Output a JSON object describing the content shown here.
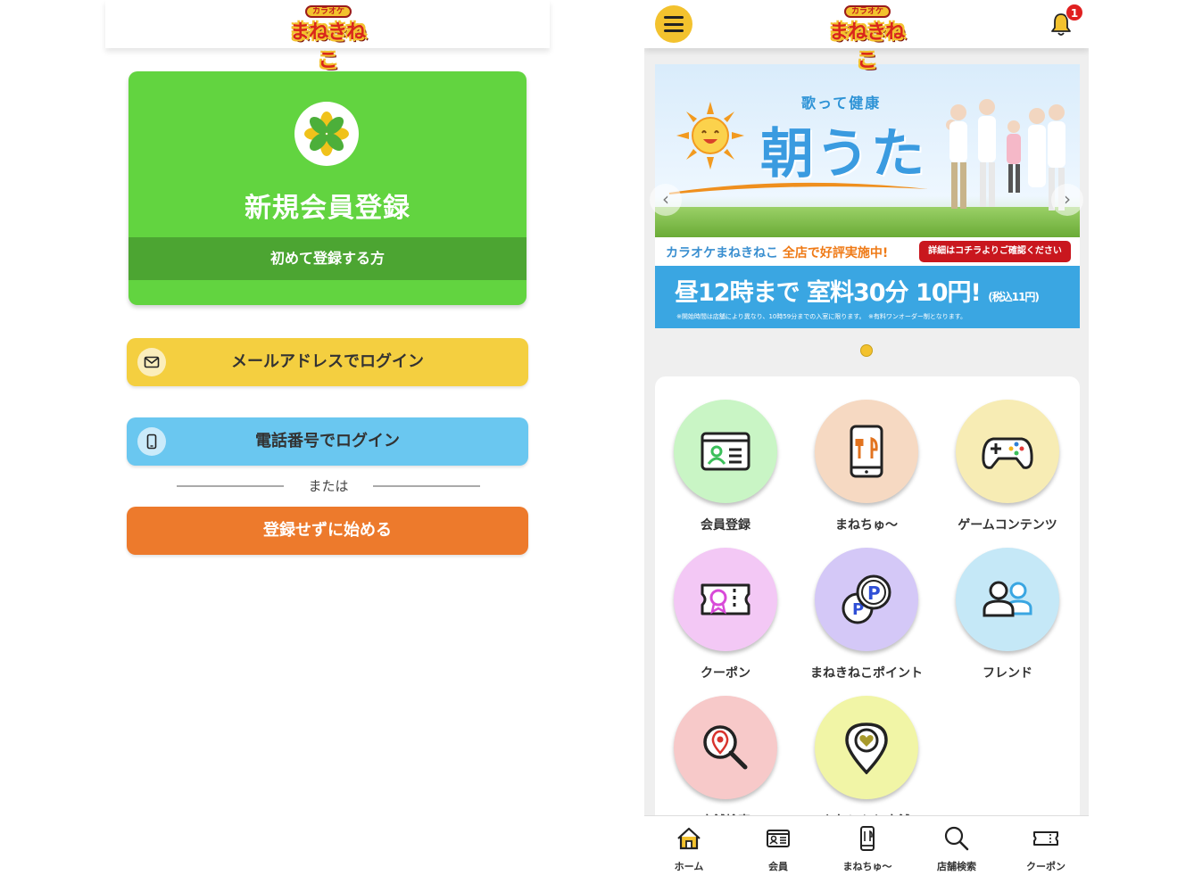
{
  "left_screen": {
    "logo": {
      "top_text": "カラオケ",
      "main_text": "まねきねこ"
    },
    "register_card": {
      "title": "新規会員登録",
      "subtitle": "初めて登録する方"
    },
    "email_login": {
      "label": "メールアドレスでログイン",
      "icon": "mail-icon"
    },
    "phone_login": {
      "label": "電話番号でログイン",
      "icon": "smartphone-icon"
    },
    "divider_text": "または",
    "guest_start": {
      "label": "登録せずに始める"
    }
  },
  "right_screen": {
    "logo": {
      "top_text": "カラオケ",
      "main_text": "まねきねこ"
    },
    "notification_count": "1",
    "banner": {
      "subtitle": "歌って健康",
      "title": "朝うた",
      "info_left_prefix": "カラオケまねきねこ",
      "info_left_highlight": "全店で好評実施中!",
      "info_right": "詳細はコチラよりご確認ください",
      "price_text": "昼12時まで 室料30分 10円!",
      "price_small": "(税込11円)",
      "note": "※開始時間は店舗により異なり、10時59分までの入室に限ります。　※有料ワンオーダー制となります。",
      "active_slide": 1,
      "slide_count": 1
    },
    "grid": [
      {
        "label": "会員登録",
        "icon": "member-card-icon",
        "color": "#c9f5c5"
      },
      {
        "label": "まねちゅ〜",
        "icon": "mobile-order-icon",
        "color": "#f6d9c2"
      },
      {
        "label": "ゲームコンテンツ",
        "icon": "game-controller-icon",
        "color": "#f7ecb4"
      },
      {
        "label": "クーポン",
        "icon": "coupon-ticket-icon",
        "color": "#f3c8f5"
      },
      {
        "label": "まねきねこポイント",
        "icon": "point-coins-icon",
        "color": "#d4c8f7"
      },
      {
        "label": "フレンド",
        "icon": "friends-icon",
        "color": "#c5e8f7"
      },
      {
        "label": "店舗検索",
        "icon": "store-search-icon",
        "color": "#f7c9c9"
      },
      {
        "label": "お気に入り店舗",
        "icon": "favorite-store-icon",
        "color": "#f1f5a6"
      }
    ],
    "tabbar": [
      {
        "label": "ホーム",
        "icon": "home-icon"
      },
      {
        "label": "会員",
        "icon": "member-card-icon"
      },
      {
        "label": "まねちゅ〜",
        "icon": "mobile-order-icon"
      },
      {
        "label": "店舗検索",
        "icon": "search-icon"
      },
      {
        "label": "クーポン",
        "icon": "coupon-icon"
      }
    ],
    "colors": {
      "accent_yellow": "#f3c22e",
      "home_active": "#f3c22e",
      "badge_red": "#e02020"
    }
  }
}
